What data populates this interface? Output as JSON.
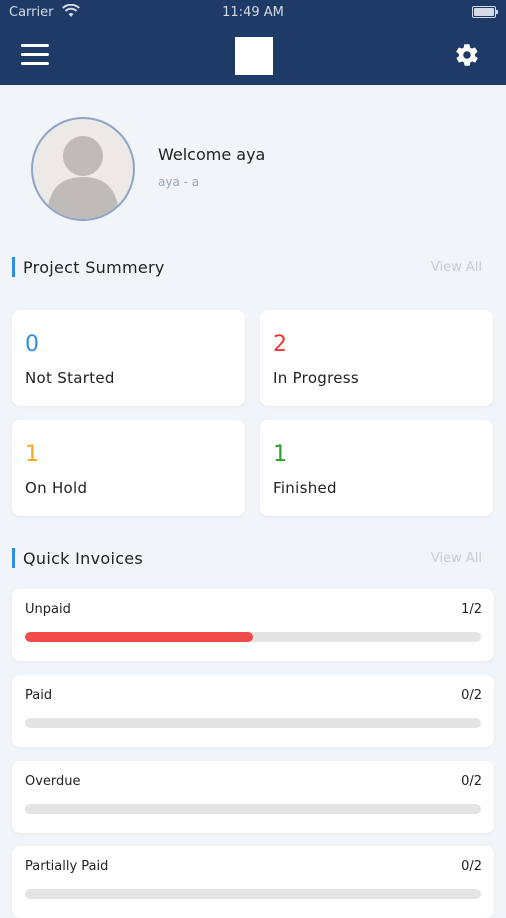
{
  "status_bar": {
    "carrier": "Carrier",
    "time": "11:49 AM"
  },
  "profile": {
    "welcome": "Welcome aya",
    "subtitle": "aya - a"
  },
  "project_summary": {
    "title": "Project Summery",
    "view_all": "View All",
    "cards": [
      {
        "count": "0",
        "label": "Not Started",
        "color": "#2d8fe0"
      },
      {
        "count": "2",
        "label": "In Progress",
        "color": "#e53935"
      },
      {
        "count": "1",
        "label": "On Hold",
        "color": "#f5a623"
      },
      {
        "count": "1",
        "label": "Finished",
        "color": "#2e9e2e"
      }
    ]
  },
  "quick_invoices": {
    "title": "Quick Invoices",
    "view_all": "View All",
    "items": [
      {
        "label": "Unpaid",
        "fraction": "1/2",
        "progress": 0.5,
        "color": "#f04b4b"
      },
      {
        "label": "Paid",
        "fraction": "0/2",
        "progress": 0,
        "color": "#f04b4b"
      },
      {
        "label": "Overdue",
        "fraction": "0/2",
        "progress": 0,
        "color": "#f04b4b"
      },
      {
        "label": "Partially Paid",
        "fraction": "0/2",
        "progress": 0,
        "color": "#f04b4b"
      }
    ]
  },
  "icons": {
    "menu": "hamburger-icon",
    "settings": "gear-icon",
    "wifi": "wifi-icon",
    "battery": "battery-icon"
  }
}
